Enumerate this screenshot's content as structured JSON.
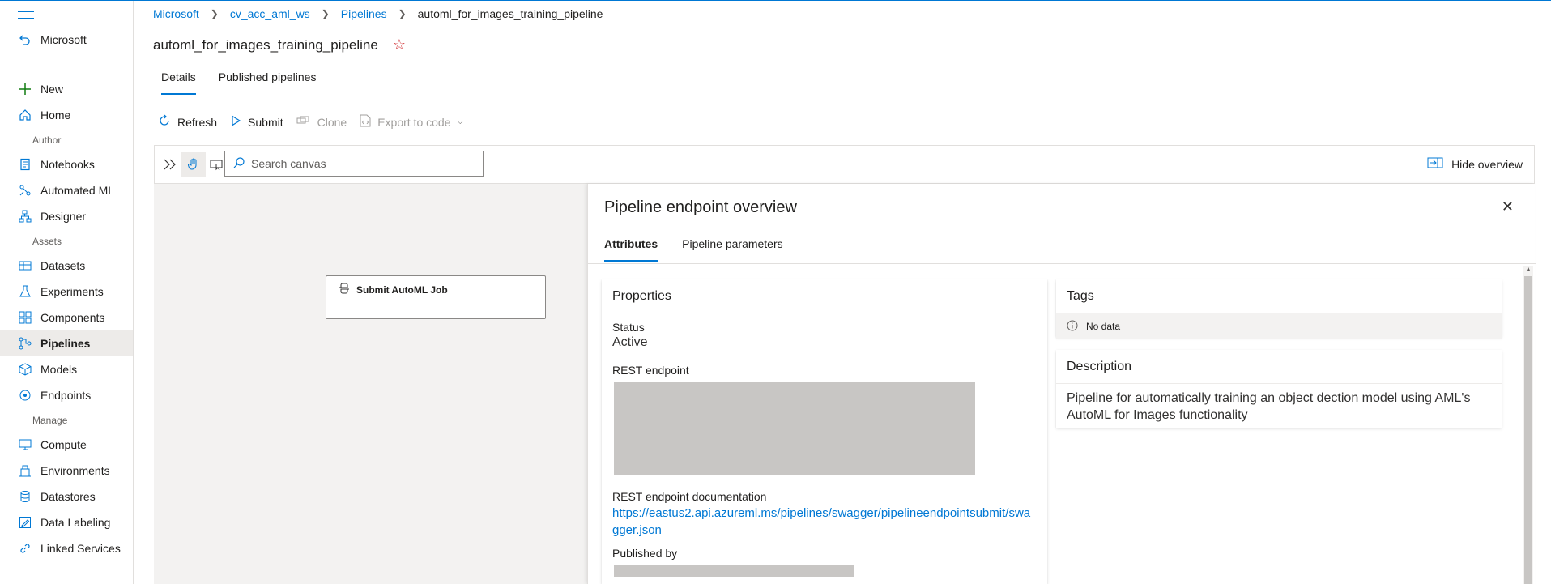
{
  "sidebar": {
    "workspace": "Microsoft",
    "items": [
      {
        "label": "New",
        "icon": "plus-icon"
      },
      {
        "label": "Home",
        "icon": "home-icon"
      },
      {
        "label": "Notebooks",
        "icon": "notebook-icon"
      },
      {
        "label": "Automated ML",
        "icon": "automl-icon"
      },
      {
        "label": "Designer",
        "icon": "designer-icon"
      },
      {
        "label": "Datasets",
        "icon": "dataset-icon"
      },
      {
        "label": "Experiments",
        "icon": "flask-icon"
      },
      {
        "label": "Components",
        "icon": "components-icon"
      },
      {
        "label": "Pipelines",
        "icon": "pipeline-icon"
      },
      {
        "label": "Models",
        "icon": "model-icon"
      },
      {
        "label": "Endpoints",
        "icon": "endpoint-icon"
      },
      {
        "label": "Compute",
        "icon": "compute-icon"
      },
      {
        "label": "Environments",
        "icon": "environment-icon"
      },
      {
        "label": "Datastores",
        "icon": "datastore-icon"
      },
      {
        "label": "Data Labeling",
        "icon": "labeling-icon"
      },
      {
        "label": "Linked Services",
        "icon": "link-icon"
      }
    ],
    "sections": {
      "author": "Author",
      "assets": "Assets",
      "manage": "Manage"
    }
  },
  "breadcrumb": {
    "items": [
      "Microsoft",
      "cv_acc_aml_ws",
      "Pipelines"
    ],
    "current": "automl_for_images_training_pipeline"
  },
  "page": {
    "title": "automl_for_images_training_pipeline",
    "tabs": [
      "Details",
      "Published pipelines"
    ]
  },
  "commands": {
    "refresh": "Refresh",
    "submit": "Submit",
    "clone": "Clone",
    "export": "Export to code"
  },
  "canvas": {
    "search_placeholder": "Search canvas",
    "hide_overview": "Hide overview",
    "node_label": "Submit AutoML Job"
  },
  "overview": {
    "title": "Pipeline endpoint overview",
    "tabs": [
      "Attributes",
      "Pipeline parameters"
    ],
    "properties": {
      "heading": "Properties",
      "status_label": "Status",
      "status_value": "Active",
      "rest_label": "REST endpoint",
      "doc_label": "REST endpoint documentation",
      "doc_link": "https://eastus2.api.azureml.ms/pipelines/swagger/pipelineendpointsubmit/swagger.json",
      "published_label": "Published by"
    },
    "tags": {
      "heading": "Tags",
      "empty": "No data"
    },
    "description": {
      "heading": "Description",
      "text": "Pipeline for automatically training an object dection model using AML's AutoML for Images functionality"
    }
  },
  "colors": {
    "accent": "#0078d4",
    "star": "#d13438"
  }
}
